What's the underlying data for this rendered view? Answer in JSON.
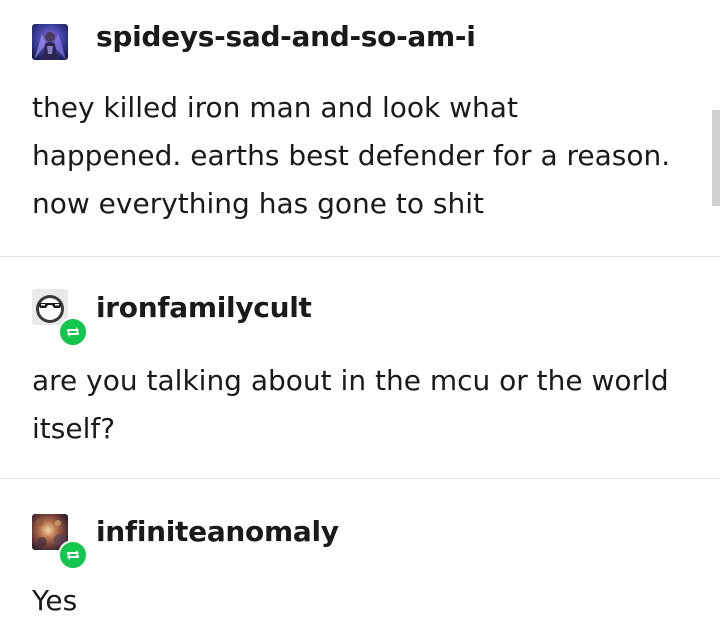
{
  "posts": [
    {
      "username": "spideys-sad-and-so-am-i",
      "avatar_icon": "character-portrait-avatar",
      "reblogged": false,
      "lines": [
        "they killed iron man and look what",
        "happened. earths best defender for a reason.",
        "now everything has gone to shit"
      ]
    },
    {
      "username": "ironfamilycult",
      "avatar_icon": "sunglasses-avatar",
      "reblogged": true,
      "lines": [
        "are you talking about in the mcu or the world",
        "itself?"
      ]
    },
    {
      "username": "infiniteanomaly",
      "avatar_icon": "galaxy-avatar",
      "reblogged": true,
      "lines": [
        "Yes"
      ]
    }
  ],
  "colors": {
    "text": "#1a1a1a",
    "divider": "#e4e4e4",
    "reblog_badge": "#14c64d",
    "background": "#ffffff"
  }
}
